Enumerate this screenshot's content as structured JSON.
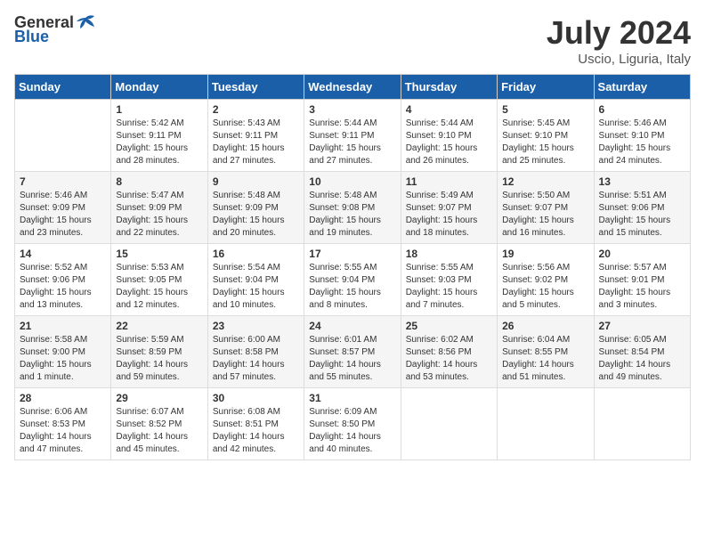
{
  "header": {
    "logo_general": "General",
    "logo_blue": "Blue",
    "month": "July 2024",
    "location": "Uscio, Liguria, Italy"
  },
  "days_of_week": [
    "Sunday",
    "Monday",
    "Tuesday",
    "Wednesday",
    "Thursday",
    "Friday",
    "Saturday"
  ],
  "weeks": [
    [
      {
        "day": "",
        "sunrise": "",
        "sunset": "",
        "daylight": ""
      },
      {
        "day": "1",
        "sunrise": "Sunrise: 5:42 AM",
        "sunset": "Sunset: 9:11 PM",
        "daylight": "Daylight: 15 hours and 28 minutes."
      },
      {
        "day": "2",
        "sunrise": "Sunrise: 5:43 AM",
        "sunset": "Sunset: 9:11 PM",
        "daylight": "Daylight: 15 hours and 27 minutes."
      },
      {
        "day": "3",
        "sunrise": "Sunrise: 5:44 AM",
        "sunset": "Sunset: 9:11 PM",
        "daylight": "Daylight: 15 hours and 27 minutes."
      },
      {
        "day": "4",
        "sunrise": "Sunrise: 5:44 AM",
        "sunset": "Sunset: 9:10 PM",
        "daylight": "Daylight: 15 hours and 26 minutes."
      },
      {
        "day": "5",
        "sunrise": "Sunrise: 5:45 AM",
        "sunset": "Sunset: 9:10 PM",
        "daylight": "Daylight: 15 hours and 25 minutes."
      },
      {
        "day": "6",
        "sunrise": "Sunrise: 5:46 AM",
        "sunset": "Sunset: 9:10 PM",
        "daylight": "Daylight: 15 hours and 24 minutes."
      }
    ],
    [
      {
        "day": "7",
        "sunrise": "Sunrise: 5:46 AM",
        "sunset": "Sunset: 9:09 PM",
        "daylight": "Daylight: 15 hours and 23 minutes."
      },
      {
        "day": "8",
        "sunrise": "Sunrise: 5:47 AM",
        "sunset": "Sunset: 9:09 PM",
        "daylight": "Daylight: 15 hours and 22 minutes."
      },
      {
        "day": "9",
        "sunrise": "Sunrise: 5:48 AM",
        "sunset": "Sunset: 9:09 PM",
        "daylight": "Daylight: 15 hours and 20 minutes."
      },
      {
        "day": "10",
        "sunrise": "Sunrise: 5:48 AM",
        "sunset": "Sunset: 9:08 PM",
        "daylight": "Daylight: 15 hours and 19 minutes."
      },
      {
        "day": "11",
        "sunrise": "Sunrise: 5:49 AM",
        "sunset": "Sunset: 9:07 PM",
        "daylight": "Daylight: 15 hours and 18 minutes."
      },
      {
        "day": "12",
        "sunrise": "Sunrise: 5:50 AM",
        "sunset": "Sunset: 9:07 PM",
        "daylight": "Daylight: 15 hours and 16 minutes."
      },
      {
        "day": "13",
        "sunrise": "Sunrise: 5:51 AM",
        "sunset": "Sunset: 9:06 PM",
        "daylight": "Daylight: 15 hours and 15 minutes."
      }
    ],
    [
      {
        "day": "14",
        "sunrise": "Sunrise: 5:52 AM",
        "sunset": "Sunset: 9:06 PM",
        "daylight": "Daylight: 15 hours and 13 minutes."
      },
      {
        "day": "15",
        "sunrise": "Sunrise: 5:53 AM",
        "sunset": "Sunset: 9:05 PM",
        "daylight": "Daylight: 15 hours and 12 minutes."
      },
      {
        "day": "16",
        "sunrise": "Sunrise: 5:54 AM",
        "sunset": "Sunset: 9:04 PM",
        "daylight": "Daylight: 15 hours and 10 minutes."
      },
      {
        "day": "17",
        "sunrise": "Sunrise: 5:55 AM",
        "sunset": "Sunset: 9:04 PM",
        "daylight": "Daylight: 15 hours and 8 minutes."
      },
      {
        "day": "18",
        "sunrise": "Sunrise: 5:55 AM",
        "sunset": "Sunset: 9:03 PM",
        "daylight": "Daylight: 15 hours and 7 minutes."
      },
      {
        "day": "19",
        "sunrise": "Sunrise: 5:56 AM",
        "sunset": "Sunset: 9:02 PM",
        "daylight": "Daylight: 15 hours and 5 minutes."
      },
      {
        "day": "20",
        "sunrise": "Sunrise: 5:57 AM",
        "sunset": "Sunset: 9:01 PM",
        "daylight": "Daylight: 15 hours and 3 minutes."
      }
    ],
    [
      {
        "day": "21",
        "sunrise": "Sunrise: 5:58 AM",
        "sunset": "Sunset: 9:00 PM",
        "daylight": "Daylight: 15 hours and 1 minute."
      },
      {
        "day": "22",
        "sunrise": "Sunrise: 5:59 AM",
        "sunset": "Sunset: 8:59 PM",
        "daylight": "Daylight: 14 hours and 59 minutes."
      },
      {
        "day": "23",
        "sunrise": "Sunrise: 6:00 AM",
        "sunset": "Sunset: 8:58 PM",
        "daylight": "Daylight: 14 hours and 57 minutes."
      },
      {
        "day": "24",
        "sunrise": "Sunrise: 6:01 AM",
        "sunset": "Sunset: 8:57 PM",
        "daylight": "Daylight: 14 hours and 55 minutes."
      },
      {
        "day": "25",
        "sunrise": "Sunrise: 6:02 AM",
        "sunset": "Sunset: 8:56 PM",
        "daylight": "Daylight: 14 hours and 53 minutes."
      },
      {
        "day": "26",
        "sunrise": "Sunrise: 6:04 AM",
        "sunset": "Sunset: 8:55 PM",
        "daylight": "Daylight: 14 hours and 51 minutes."
      },
      {
        "day": "27",
        "sunrise": "Sunrise: 6:05 AM",
        "sunset": "Sunset: 8:54 PM",
        "daylight": "Daylight: 14 hours and 49 minutes."
      }
    ],
    [
      {
        "day": "28",
        "sunrise": "Sunrise: 6:06 AM",
        "sunset": "Sunset: 8:53 PM",
        "daylight": "Daylight: 14 hours and 47 minutes."
      },
      {
        "day": "29",
        "sunrise": "Sunrise: 6:07 AM",
        "sunset": "Sunset: 8:52 PM",
        "daylight": "Daylight: 14 hours and 45 minutes."
      },
      {
        "day": "30",
        "sunrise": "Sunrise: 6:08 AM",
        "sunset": "Sunset: 8:51 PM",
        "daylight": "Daylight: 14 hours and 42 minutes."
      },
      {
        "day": "31",
        "sunrise": "Sunrise: 6:09 AM",
        "sunset": "Sunset: 8:50 PM",
        "daylight": "Daylight: 14 hours and 40 minutes."
      },
      {
        "day": "",
        "sunrise": "",
        "sunset": "",
        "daylight": ""
      },
      {
        "day": "",
        "sunrise": "",
        "sunset": "",
        "daylight": ""
      },
      {
        "day": "",
        "sunrise": "",
        "sunset": "",
        "daylight": ""
      }
    ]
  ]
}
